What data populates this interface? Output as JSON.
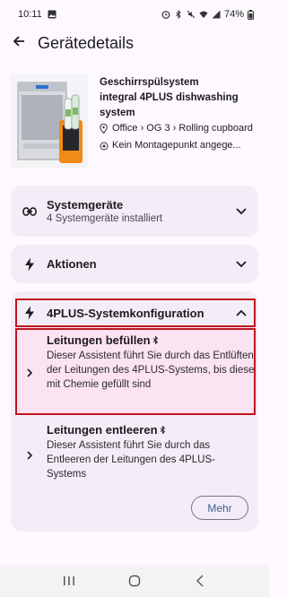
{
  "status_bar": {
    "time": "10:11",
    "battery": "74%"
  },
  "header": {
    "title": "Gerätedetails"
  },
  "device": {
    "name_line1": "Geschirrspülsystem",
    "name_line2": "integral 4PLUS dishwashing system",
    "location": "Office › OG 3 › Rolling cupboard",
    "mount": "Kein Montagepunkt angege..."
  },
  "sections": {
    "systemgeraete": {
      "title": "Systemgeräte",
      "subtitle": "4 Systemgeräte installiert"
    },
    "aktionen": {
      "title": "Aktionen"
    },
    "konfiguration": {
      "title": "4PLUS-Systemkonfiguration",
      "items": [
        {
          "title": "Leitungen befüllen",
          "description": "Dieser Assistent führt Sie durch das Entlüften der Leitungen des 4PLUS-Systems, bis diese mit Chemie gefüllt sind"
        },
        {
          "title": "Leitungen entleeren",
          "description": "Dieser Assistent führt Sie durch das Entleeren der Leitungen des 4PLUS-Systems"
        }
      ],
      "more_label": "Mehr"
    }
  },
  "colors": {
    "highlight_border": "#c0141c",
    "highlight_fill": "#fbe3f2",
    "card_bg": "#f3edf7"
  },
  "icons": [
    "back-arrow-icon",
    "link-icon",
    "lightning-icon",
    "bluetooth-icon",
    "chevron-down-icon",
    "chevron-up-icon",
    "chevron-right-icon",
    "location-pin-icon",
    "target-icon"
  ]
}
